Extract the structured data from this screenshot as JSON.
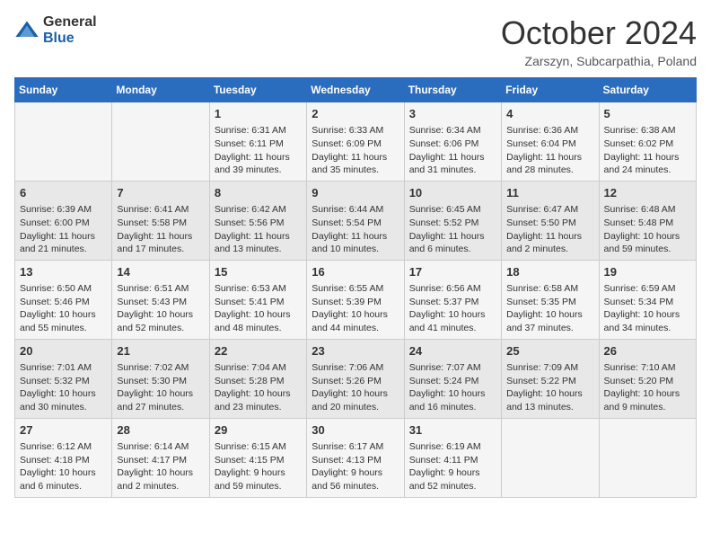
{
  "header": {
    "logo_general": "General",
    "logo_blue": "Blue",
    "month_title": "October 2024",
    "location": "Zarszyn, Subcarpathia, Poland"
  },
  "weekdays": [
    "Sunday",
    "Monday",
    "Tuesday",
    "Wednesday",
    "Thursday",
    "Friday",
    "Saturday"
  ],
  "weeks": [
    [
      {
        "day": "",
        "content": ""
      },
      {
        "day": "",
        "content": ""
      },
      {
        "day": "1",
        "content": "Sunrise: 6:31 AM\nSunset: 6:11 PM\nDaylight: 11 hours and 39 minutes."
      },
      {
        "day": "2",
        "content": "Sunrise: 6:33 AM\nSunset: 6:09 PM\nDaylight: 11 hours and 35 minutes."
      },
      {
        "day": "3",
        "content": "Sunrise: 6:34 AM\nSunset: 6:06 PM\nDaylight: 11 hours and 31 minutes."
      },
      {
        "day": "4",
        "content": "Sunrise: 6:36 AM\nSunset: 6:04 PM\nDaylight: 11 hours and 28 minutes."
      },
      {
        "day": "5",
        "content": "Sunrise: 6:38 AM\nSunset: 6:02 PM\nDaylight: 11 hours and 24 minutes."
      }
    ],
    [
      {
        "day": "6",
        "content": "Sunrise: 6:39 AM\nSunset: 6:00 PM\nDaylight: 11 hours and 21 minutes."
      },
      {
        "day": "7",
        "content": "Sunrise: 6:41 AM\nSunset: 5:58 PM\nDaylight: 11 hours and 17 minutes."
      },
      {
        "day": "8",
        "content": "Sunrise: 6:42 AM\nSunset: 5:56 PM\nDaylight: 11 hours and 13 minutes."
      },
      {
        "day": "9",
        "content": "Sunrise: 6:44 AM\nSunset: 5:54 PM\nDaylight: 11 hours and 10 minutes."
      },
      {
        "day": "10",
        "content": "Sunrise: 6:45 AM\nSunset: 5:52 PM\nDaylight: 11 hours and 6 minutes."
      },
      {
        "day": "11",
        "content": "Sunrise: 6:47 AM\nSunset: 5:50 PM\nDaylight: 11 hours and 2 minutes."
      },
      {
        "day": "12",
        "content": "Sunrise: 6:48 AM\nSunset: 5:48 PM\nDaylight: 10 hours and 59 minutes."
      }
    ],
    [
      {
        "day": "13",
        "content": "Sunrise: 6:50 AM\nSunset: 5:46 PM\nDaylight: 10 hours and 55 minutes."
      },
      {
        "day": "14",
        "content": "Sunrise: 6:51 AM\nSunset: 5:43 PM\nDaylight: 10 hours and 52 minutes."
      },
      {
        "day": "15",
        "content": "Sunrise: 6:53 AM\nSunset: 5:41 PM\nDaylight: 10 hours and 48 minutes."
      },
      {
        "day": "16",
        "content": "Sunrise: 6:55 AM\nSunset: 5:39 PM\nDaylight: 10 hours and 44 minutes."
      },
      {
        "day": "17",
        "content": "Sunrise: 6:56 AM\nSunset: 5:37 PM\nDaylight: 10 hours and 41 minutes."
      },
      {
        "day": "18",
        "content": "Sunrise: 6:58 AM\nSunset: 5:35 PM\nDaylight: 10 hours and 37 minutes."
      },
      {
        "day": "19",
        "content": "Sunrise: 6:59 AM\nSunset: 5:34 PM\nDaylight: 10 hours and 34 minutes."
      }
    ],
    [
      {
        "day": "20",
        "content": "Sunrise: 7:01 AM\nSunset: 5:32 PM\nDaylight: 10 hours and 30 minutes."
      },
      {
        "day": "21",
        "content": "Sunrise: 7:02 AM\nSunset: 5:30 PM\nDaylight: 10 hours and 27 minutes."
      },
      {
        "day": "22",
        "content": "Sunrise: 7:04 AM\nSunset: 5:28 PM\nDaylight: 10 hours and 23 minutes."
      },
      {
        "day": "23",
        "content": "Sunrise: 7:06 AM\nSunset: 5:26 PM\nDaylight: 10 hours and 20 minutes."
      },
      {
        "day": "24",
        "content": "Sunrise: 7:07 AM\nSunset: 5:24 PM\nDaylight: 10 hours and 16 minutes."
      },
      {
        "day": "25",
        "content": "Sunrise: 7:09 AM\nSunset: 5:22 PM\nDaylight: 10 hours and 13 minutes."
      },
      {
        "day": "26",
        "content": "Sunrise: 7:10 AM\nSunset: 5:20 PM\nDaylight: 10 hours and 9 minutes."
      }
    ],
    [
      {
        "day": "27",
        "content": "Sunrise: 6:12 AM\nSunset: 4:18 PM\nDaylight: 10 hours and 6 minutes."
      },
      {
        "day": "28",
        "content": "Sunrise: 6:14 AM\nSunset: 4:17 PM\nDaylight: 10 hours and 2 minutes."
      },
      {
        "day": "29",
        "content": "Sunrise: 6:15 AM\nSunset: 4:15 PM\nDaylight: 9 hours and 59 minutes."
      },
      {
        "day": "30",
        "content": "Sunrise: 6:17 AM\nSunset: 4:13 PM\nDaylight: 9 hours and 56 minutes."
      },
      {
        "day": "31",
        "content": "Sunrise: 6:19 AM\nSunset: 4:11 PM\nDaylight: 9 hours and 52 minutes."
      },
      {
        "day": "",
        "content": ""
      },
      {
        "day": "",
        "content": ""
      }
    ]
  ]
}
